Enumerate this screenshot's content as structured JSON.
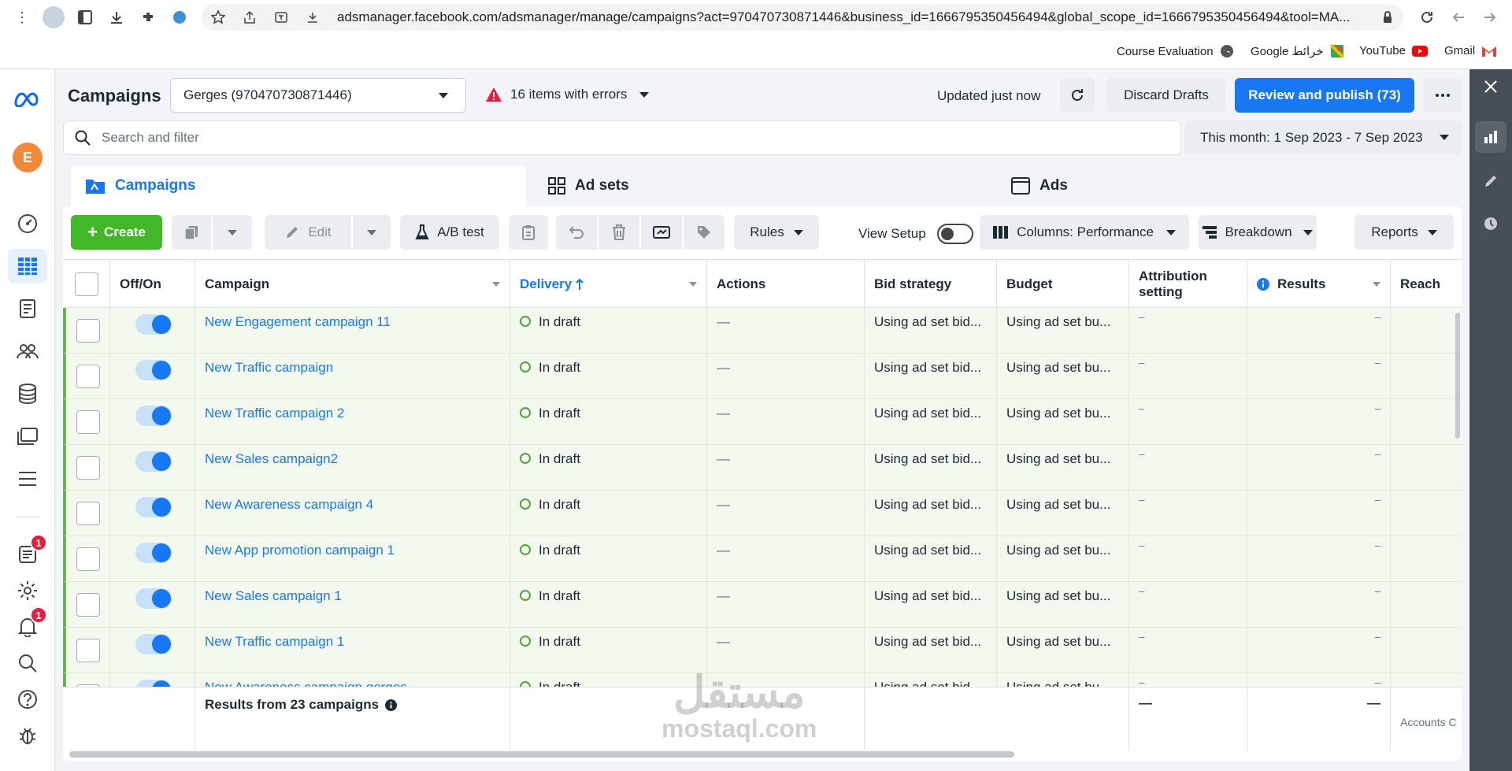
{
  "browser": {
    "url": "adsmanager.facebook.com/adsmanager/manage/campaigns?act=970470730871446&business_id=1666795350456494&global_scope_id=1666795350456494&tool=MA...",
    "bookmarks": [
      {
        "label": "Course Evaluation"
      },
      {
        "label": "Google خرائط"
      },
      {
        "label": "YouTube"
      },
      {
        "label": "Gmail"
      }
    ]
  },
  "leftnav": {
    "avatar_letter": "E",
    "badge_a": "1",
    "badge_b": "1"
  },
  "header": {
    "title": "Campaigns",
    "account": "Gerges (970470730871446)",
    "errors": "16 items with errors",
    "updated": "Updated just now",
    "discard": "Discard Drafts",
    "publish": "Review and publish (73)"
  },
  "search": {
    "placeholder": "Search and filter",
    "date_range": "This month: 1 Sep 2023 - 7 Sep 2023"
  },
  "tabs": [
    {
      "label": "Campaigns"
    },
    {
      "label": "Ad sets"
    },
    {
      "label": "Ads"
    }
  ],
  "toolbar": {
    "create": "Create",
    "edit": "Edit",
    "ab_test": "A/B test",
    "rules": "Rules",
    "view_setup": "View Setup",
    "columns": "Columns: Performance",
    "breakdown": "Breakdown",
    "reports": "Reports"
  },
  "columns": {
    "offon": "Off/On",
    "campaign": "Campaign",
    "delivery": "Delivery",
    "actions": "Actions",
    "bid": "Bid strategy",
    "budget": "Budget",
    "attribution": "Attribution setting",
    "results": "Results",
    "reach": "Reach"
  },
  "rows": [
    {
      "name": "New Engagement campaign 11",
      "delivery": "In draft",
      "actions": "—",
      "bid": "Using ad set bid...",
      "budget": "Using ad set bu...",
      "attribution": "–",
      "results": "–"
    },
    {
      "name": "New Traffic campaign",
      "delivery": "In draft",
      "actions": "—",
      "bid": "Using ad set bid...",
      "budget": "Using ad set bu...",
      "attribution": "–",
      "results": "–"
    },
    {
      "name": "New Traffic campaign 2",
      "delivery": "In draft",
      "actions": "—",
      "bid": "Using ad set bid...",
      "budget": "Using ad set bu...",
      "attribution": "–",
      "results": "–"
    },
    {
      "name": "New Sales campaign2",
      "delivery": "In draft",
      "actions": "—",
      "bid": "Using ad set bid...",
      "budget": "Using ad set bu...",
      "attribution": "–",
      "results": "–"
    },
    {
      "name": "New Awareness campaign 4",
      "delivery": "In draft",
      "actions": "—",
      "bid": "Using ad set bid...",
      "budget": "Using ad set bu...",
      "attribution": "–",
      "results": "–"
    },
    {
      "name": "New App promotion campaign 1",
      "delivery": "In draft",
      "actions": "—",
      "bid": "Using ad set bid...",
      "budget": "Using ad set bu...",
      "attribution": "–",
      "results": "–"
    },
    {
      "name": "New Sales campaign 1",
      "delivery": "In draft",
      "actions": "—",
      "bid": "Using ad set bid...",
      "budget": "Using ad set bu...",
      "attribution": "–",
      "results": "–"
    },
    {
      "name": "New Traffic campaign 1",
      "delivery": "In draft",
      "actions": "—",
      "bid": "Using ad set bid...",
      "budget": "Using ad set bu...",
      "attribution": "–",
      "results": "–"
    },
    {
      "name": "New Awareness campaign gerges",
      "delivery": "In draft",
      "actions": "—",
      "bid": "Using ad set bid...",
      "budget": "Using ad set bu...",
      "attribution": "–",
      "results": "–"
    }
  ],
  "footer": {
    "summary": "Results from 23 campaigns",
    "attribution": "—",
    "results": "—",
    "reach": "Accounts C"
  },
  "watermark": {
    "arabic": "مستقل",
    "latin": "mostaql.com"
  }
}
